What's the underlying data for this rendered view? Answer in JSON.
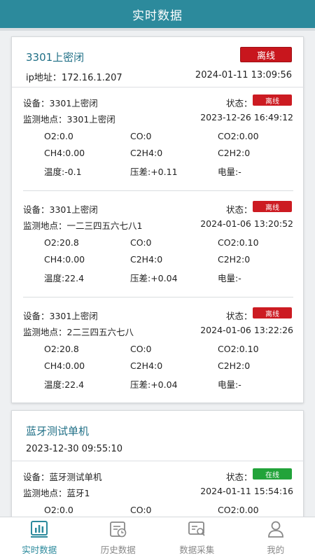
{
  "header": {
    "title": "实时数据"
  },
  "colors": {
    "accent": "#2c8a9c",
    "offline": "#c8161d",
    "online": "#22a33a"
  },
  "cards": [
    {
      "title": "3301上密闭",
      "status_button": "离线",
      "ip": "ip地址：172.16.1.207",
      "time": "2024-01-11 13:09:56",
      "devices": [
        {
          "name": "设备：3301上密闭",
          "status_label": "状态：",
          "status": "离线",
          "location": "监测地点：3301上密闭",
          "time": "2023-12-26 16:49:12",
          "readings": [
            "O2:0.0",
            "CO:0",
            "CO2:0.00",
            "CH4:0.00",
            "C2H4:0",
            "C2H2:0",
            "温度:-0.1",
            "压差:+0.11",
            "电量:-"
          ]
        },
        {
          "name": "设备：3301上密闭",
          "status_label": "状态：",
          "status": "离线",
          "location": "监测地点：一二三四五六七八1",
          "time": "2024-01-06 13:20:52",
          "readings": [
            "O2:20.8",
            "CO:0",
            "CO2:0.10",
            "CH4:0.00",
            "C2H4:0",
            "C2H2:0",
            "温度:22.4",
            "压差:+0.04",
            "电量:-"
          ]
        },
        {
          "name": "设备：3301上密闭",
          "status_label": "状态：",
          "status": "离线",
          "location": "监测地点：2二三四五六七八",
          "time": "2024-01-06 13:22:26",
          "readings": [
            "O2:20.8",
            "CO:0",
            "CO2:0.10",
            "CH4:0.00",
            "C2H4:0",
            "C2H2:0",
            "温度:22.4",
            "压差:+0.04",
            "电量:-"
          ]
        }
      ]
    },
    {
      "title": "蓝牙测试单机",
      "time": "2023-12-30 09:55:10",
      "devices": [
        {
          "name": "设备：蓝牙测试单机",
          "status_label": "状态：",
          "status": "在线",
          "location": "监测地点：蓝牙1",
          "time": "2024-01-11 15:54:16",
          "readings": [
            "O2:0.0",
            "CO:0",
            "CO2:0.00"
          ]
        }
      ]
    }
  ],
  "nav": [
    {
      "label": "实时数据",
      "icon": "bar-chart-icon",
      "active": true
    },
    {
      "label": "历史数据",
      "icon": "history-icon",
      "active": false
    },
    {
      "label": "数据采集",
      "icon": "data-collect-icon",
      "active": false
    },
    {
      "label": "我的",
      "icon": "user-icon",
      "active": false
    }
  ]
}
